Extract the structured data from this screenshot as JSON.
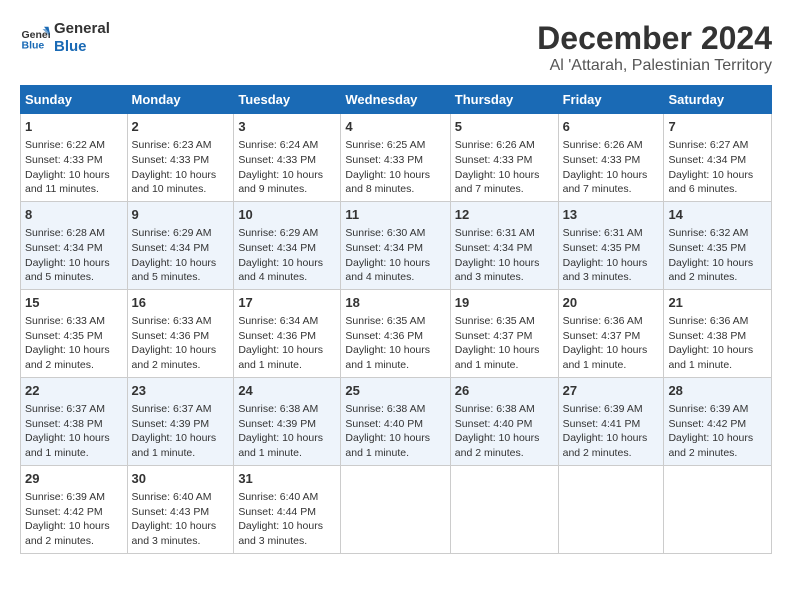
{
  "header": {
    "logo_line1": "General",
    "logo_line2": "Blue",
    "title": "December 2024",
    "subtitle": "Al 'Attarah, Palestinian Territory"
  },
  "days_of_week": [
    "Sunday",
    "Monday",
    "Tuesday",
    "Wednesday",
    "Thursday",
    "Friday",
    "Saturday"
  ],
  "weeks": [
    [
      {
        "day": "1",
        "info": "Sunrise: 6:22 AM\nSunset: 4:33 PM\nDaylight: 10 hours and 11 minutes."
      },
      {
        "day": "2",
        "info": "Sunrise: 6:23 AM\nSunset: 4:33 PM\nDaylight: 10 hours and 10 minutes."
      },
      {
        "day": "3",
        "info": "Sunrise: 6:24 AM\nSunset: 4:33 PM\nDaylight: 10 hours and 9 minutes."
      },
      {
        "day": "4",
        "info": "Sunrise: 6:25 AM\nSunset: 4:33 PM\nDaylight: 10 hours and 8 minutes."
      },
      {
        "day": "5",
        "info": "Sunrise: 6:26 AM\nSunset: 4:33 PM\nDaylight: 10 hours and 7 minutes."
      },
      {
        "day": "6",
        "info": "Sunrise: 6:26 AM\nSunset: 4:33 PM\nDaylight: 10 hours and 7 minutes."
      },
      {
        "day": "7",
        "info": "Sunrise: 6:27 AM\nSunset: 4:34 PM\nDaylight: 10 hours and 6 minutes."
      }
    ],
    [
      {
        "day": "8",
        "info": "Sunrise: 6:28 AM\nSunset: 4:34 PM\nDaylight: 10 hours and 5 minutes."
      },
      {
        "day": "9",
        "info": "Sunrise: 6:29 AM\nSunset: 4:34 PM\nDaylight: 10 hours and 5 minutes."
      },
      {
        "day": "10",
        "info": "Sunrise: 6:29 AM\nSunset: 4:34 PM\nDaylight: 10 hours and 4 minutes."
      },
      {
        "day": "11",
        "info": "Sunrise: 6:30 AM\nSunset: 4:34 PM\nDaylight: 10 hours and 4 minutes."
      },
      {
        "day": "12",
        "info": "Sunrise: 6:31 AM\nSunset: 4:34 PM\nDaylight: 10 hours and 3 minutes."
      },
      {
        "day": "13",
        "info": "Sunrise: 6:31 AM\nSunset: 4:35 PM\nDaylight: 10 hours and 3 minutes."
      },
      {
        "day": "14",
        "info": "Sunrise: 6:32 AM\nSunset: 4:35 PM\nDaylight: 10 hours and 2 minutes."
      }
    ],
    [
      {
        "day": "15",
        "info": "Sunrise: 6:33 AM\nSunset: 4:35 PM\nDaylight: 10 hours and 2 minutes."
      },
      {
        "day": "16",
        "info": "Sunrise: 6:33 AM\nSunset: 4:36 PM\nDaylight: 10 hours and 2 minutes."
      },
      {
        "day": "17",
        "info": "Sunrise: 6:34 AM\nSunset: 4:36 PM\nDaylight: 10 hours and 1 minute."
      },
      {
        "day": "18",
        "info": "Sunrise: 6:35 AM\nSunset: 4:36 PM\nDaylight: 10 hours and 1 minute."
      },
      {
        "day": "19",
        "info": "Sunrise: 6:35 AM\nSunset: 4:37 PM\nDaylight: 10 hours and 1 minute."
      },
      {
        "day": "20",
        "info": "Sunrise: 6:36 AM\nSunset: 4:37 PM\nDaylight: 10 hours and 1 minute."
      },
      {
        "day": "21",
        "info": "Sunrise: 6:36 AM\nSunset: 4:38 PM\nDaylight: 10 hours and 1 minute."
      }
    ],
    [
      {
        "day": "22",
        "info": "Sunrise: 6:37 AM\nSunset: 4:38 PM\nDaylight: 10 hours and 1 minute."
      },
      {
        "day": "23",
        "info": "Sunrise: 6:37 AM\nSunset: 4:39 PM\nDaylight: 10 hours and 1 minute."
      },
      {
        "day": "24",
        "info": "Sunrise: 6:38 AM\nSunset: 4:39 PM\nDaylight: 10 hours and 1 minute."
      },
      {
        "day": "25",
        "info": "Sunrise: 6:38 AM\nSunset: 4:40 PM\nDaylight: 10 hours and 1 minute."
      },
      {
        "day": "26",
        "info": "Sunrise: 6:38 AM\nSunset: 4:40 PM\nDaylight: 10 hours and 2 minutes."
      },
      {
        "day": "27",
        "info": "Sunrise: 6:39 AM\nSunset: 4:41 PM\nDaylight: 10 hours and 2 minutes."
      },
      {
        "day": "28",
        "info": "Sunrise: 6:39 AM\nSunset: 4:42 PM\nDaylight: 10 hours and 2 minutes."
      }
    ],
    [
      {
        "day": "29",
        "info": "Sunrise: 6:39 AM\nSunset: 4:42 PM\nDaylight: 10 hours and 2 minutes."
      },
      {
        "day": "30",
        "info": "Sunrise: 6:40 AM\nSunset: 4:43 PM\nDaylight: 10 hours and 3 minutes."
      },
      {
        "day": "31",
        "info": "Sunrise: 6:40 AM\nSunset: 4:44 PM\nDaylight: 10 hours and 3 minutes."
      },
      null,
      null,
      null,
      null
    ]
  ]
}
